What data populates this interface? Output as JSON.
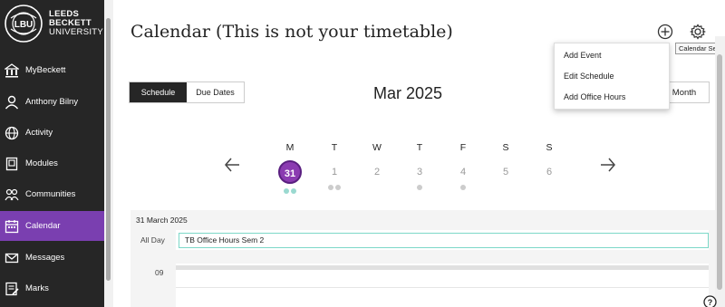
{
  "brand": {
    "line1": "LEEDS",
    "line2": "BECKETT",
    "line3": "UNIVERSITY",
    "seal_text": "LBU"
  },
  "sidebar": {
    "items": [
      {
        "label": "MyBeckett",
        "icon": "bank-icon"
      },
      {
        "label": "Anthony Bilny",
        "icon": "user-icon"
      },
      {
        "label": "Activity",
        "icon": "globe-icon"
      },
      {
        "label": "Modules",
        "icon": "book-icon"
      },
      {
        "label": "Communities",
        "icon": "people-icon"
      },
      {
        "label": "Calendar",
        "icon": "calendar-icon",
        "active": true
      },
      {
        "label": "Messages",
        "icon": "envelope-icon"
      },
      {
        "label": "Marks",
        "icon": "marks-icon"
      }
    ],
    "active_color": "#7a3fb0"
  },
  "header": {
    "title": "Calendar (This is not your timetable)",
    "add_icon": "plus-circle-icon",
    "settings_icon": "gear-icon",
    "tooltip": "Calendar Settings"
  },
  "menu": {
    "items": [
      "Add Event",
      "Edit Schedule",
      "Add Office Hours"
    ]
  },
  "views": {
    "schedule": "Schedule",
    "due_dates": "Due Dates",
    "month": "Month",
    "current_month": "Mar 2025"
  },
  "week": {
    "days": [
      {
        "letter": "M",
        "num": "31",
        "selected": true,
        "dots": [
          "teal",
          "teal"
        ]
      },
      {
        "letter": "T",
        "num": "1",
        "dots": [
          "grey",
          "grey"
        ]
      },
      {
        "letter": "W",
        "num": "2",
        "dots": []
      },
      {
        "letter": "T",
        "num": "3",
        "dots": [
          "grey"
        ]
      },
      {
        "letter": "F",
        "num": "4",
        "dots": [
          "grey"
        ]
      },
      {
        "letter": "S",
        "num": "5",
        "dots": []
      },
      {
        "letter": "S",
        "num": "6",
        "dots": []
      }
    ],
    "accent": "#8b3bb1"
  },
  "schedule": {
    "date": "31 March 2025",
    "all_day_label": "All Day",
    "event": "TB Office Hours Sem 2",
    "time_label": "09"
  }
}
